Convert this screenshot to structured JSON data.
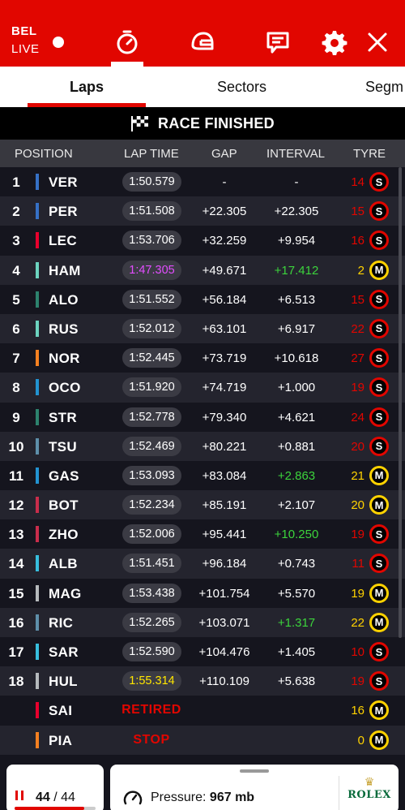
{
  "session": {
    "code": "BEL",
    "status": "LIVE"
  },
  "tabs": [
    "Laps",
    "Sectors",
    "Segm"
  ],
  "banner": {
    "label": "RACE FINISHED"
  },
  "columns": {
    "position": "POSITION",
    "lap_time": "LAP TIME",
    "gap": "GAP",
    "interval": "INTERVAL",
    "tyre": "TYRE"
  },
  "colors": {
    "accent": "#e10600",
    "purple_best": "#e34dff",
    "personal_best": "#ffe600",
    "gain": "#3cd33c",
    "soft": "#e10600",
    "medium": "#ffd200"
  },
  "rows": [
    {
      "pos": "1",
      "code": "VER",
      "team_color": "#3671c6",
      "lap": "1:50.579",
      "gap": "-",
      "int": "-",
      "laps": "14",
      "tyre": "S"
    },
    {
      "pos": "2",
      "code": "PER",
      "team_color": "#3671c6",
      "lap": "1:51.508",
      "gap": "+22.305",
      "int": "+22.305",
      "laps": "15",
      "tyre": "S"
    },
    {
      "pos": "3",
      "code": "LEC",
      "team_color": "#e8002d",
      "lap": "1:53.706",
      "gap": "+32.259",
      "int": "+9.954",
      "laps": "16",
      "tyre": "S"
    },
    {
      "pos": "4",
      "code": "HAM",
      "team_color": "#6cd3bf",
      "lap": "1:47.305",
      "lap_style": "purple",
      "gap": "+49.671",
      "int": "+17.412",
      "int_style": "green",
      "laps": "2",
      "tyre": "M"
    },
    {
      "pos": "5",
      "code": "ALO",
      "team_color": "#2d826d",
      "lap": "1:51.552",
      "gap": "+56.184",
      "int": "+6.513",
      "laps": "15",
      "tyre": "S"
    },
    {
      "pos": "6",
      "code": "RUS",
      "team_color": "#6cd3bf",
      "lap": "1:52.012",
      "gap": "+63.101",
      "int": "+6.917",
      "laps": "22",
      "tyre": "S"
    },
    {
      "pos": "7",
      "code": "NOR",
      "team_color": "#f58020",
      "lap": "1:52.445",
      "gap": "+73.719",
      "int": "+10.618",
      "laps": "27",
      "tyre": "S"
    },
    {
      "pos": "8",
      "code": "OCO",
      "team_color": "#2293d1",
      "lap": "1:51.920",
      "gap": "+74.719",
      "int": "+1.000",
      "laps": "19",
      "tyre": "S"
    },
    {
      "pos": "9",
      "code": "STR",
      "team_color": "#2d826d",
      "lap": "1:52.778",
      "gap": "+79.340",
      "int": "+4.621",
      "laps": "24",
      "tyre": "S"
    },
    {
      "pos": "10",
      "code": "TSU",
      "team_color": "#5e8faa",
      "lap": "1:52.469",
      "gap": "+80.221",
      "int": "+0.881",
      "laps": "20",
      "tyre": "S"
    },
    {
      "pos": "11",
      "code": "GAS",
      "team_color": "#2293d1",
      "lap": "1:53.093",
      "gap": "+83.084",
      "int": "+2.863",
      "int_style": "green",
      "laps": "21",
      "tyre": "M"
    },
    {
      "pos": "12",
      "code": "BOT",
      "team_color": "#c92d4b",
      "lap": "1:52.234",
      "gap": "+85.191",
      "int": "+2.107",
      "laps": "20",
      "tyre": "M"
    },
    {
      "pos": "13",
      "code": "ZHO",
      "team_color": "#c92d4b",
      "lap": "1:52.006",
      "gap": "+95.441",
      "int": "+10.250",
      "int_style": "green",
      "laps": "19",
      "tyre": "S"
    },
    {
      "pos": "14",
      "code": "ALB",
      "team_color": "#37bedd",
      "lap": "1:51.451",
      "gap": "+96.184",
      "int": "+0.743",
      "laps": "11",
      "tyre": "S"
    },
    {
      "pos": "15",
      "code": "MAG",
      "team_color": "#b6babd",
      "lap": "1:53.438",
      "gap": "+101.754",
      "int": "+5.570",
      "laps": "19",
      "tyre": "M"
    },
    {
      "pos": "16",
      "code": "RIC",
      "team_color": "#5e8faa",
      "lap": "1:52.265",
      "gap": "+103.071",
      "int": "+1.317",
      "int_style": "green",
      "laps": "22",
      "tyre": "M"
    },
    {
      "pos": "17",
      "code": "SAR",
      "team_color": "#37bedd",
      "lap": "1:52.590",
      "gap": "+104.476",
      "int": "+1.405",
      "laps": "10",
      "tyre": "S"
    },
    {
      "pos": "18",
      "code": "HUL",
      "team_color": "#b6babd",
      "lap": "1:55.314",
      "lap_style": "yellow",
      "gap": "+110.109",
      "int": "+5.638",
      "laps": "19",
      "tyre": "S"
    },
    {
      "pos": "",
      "code": "SAI",
      "team_color": "#e8002d",
      "status": "RETIRED",
      "laps": "16",
      "tyre": "M"
    },
    {
      "pos": "",
      "code": "PIA",
      "team_color": "#f58020",
      "status": "STOP",
      "laps": "0",
      "tyre": "M"
    }
  ],
  "bottom": {
    "laps_current": "44",
    "laps_sep": "/",
    "laps_total": "44",
    "laps_progress": 0.86,
    "pressure_label": "Pressure:",
    "pressure_value": "967 mb",
    "sponsor": "ROLEX"
  }
}
